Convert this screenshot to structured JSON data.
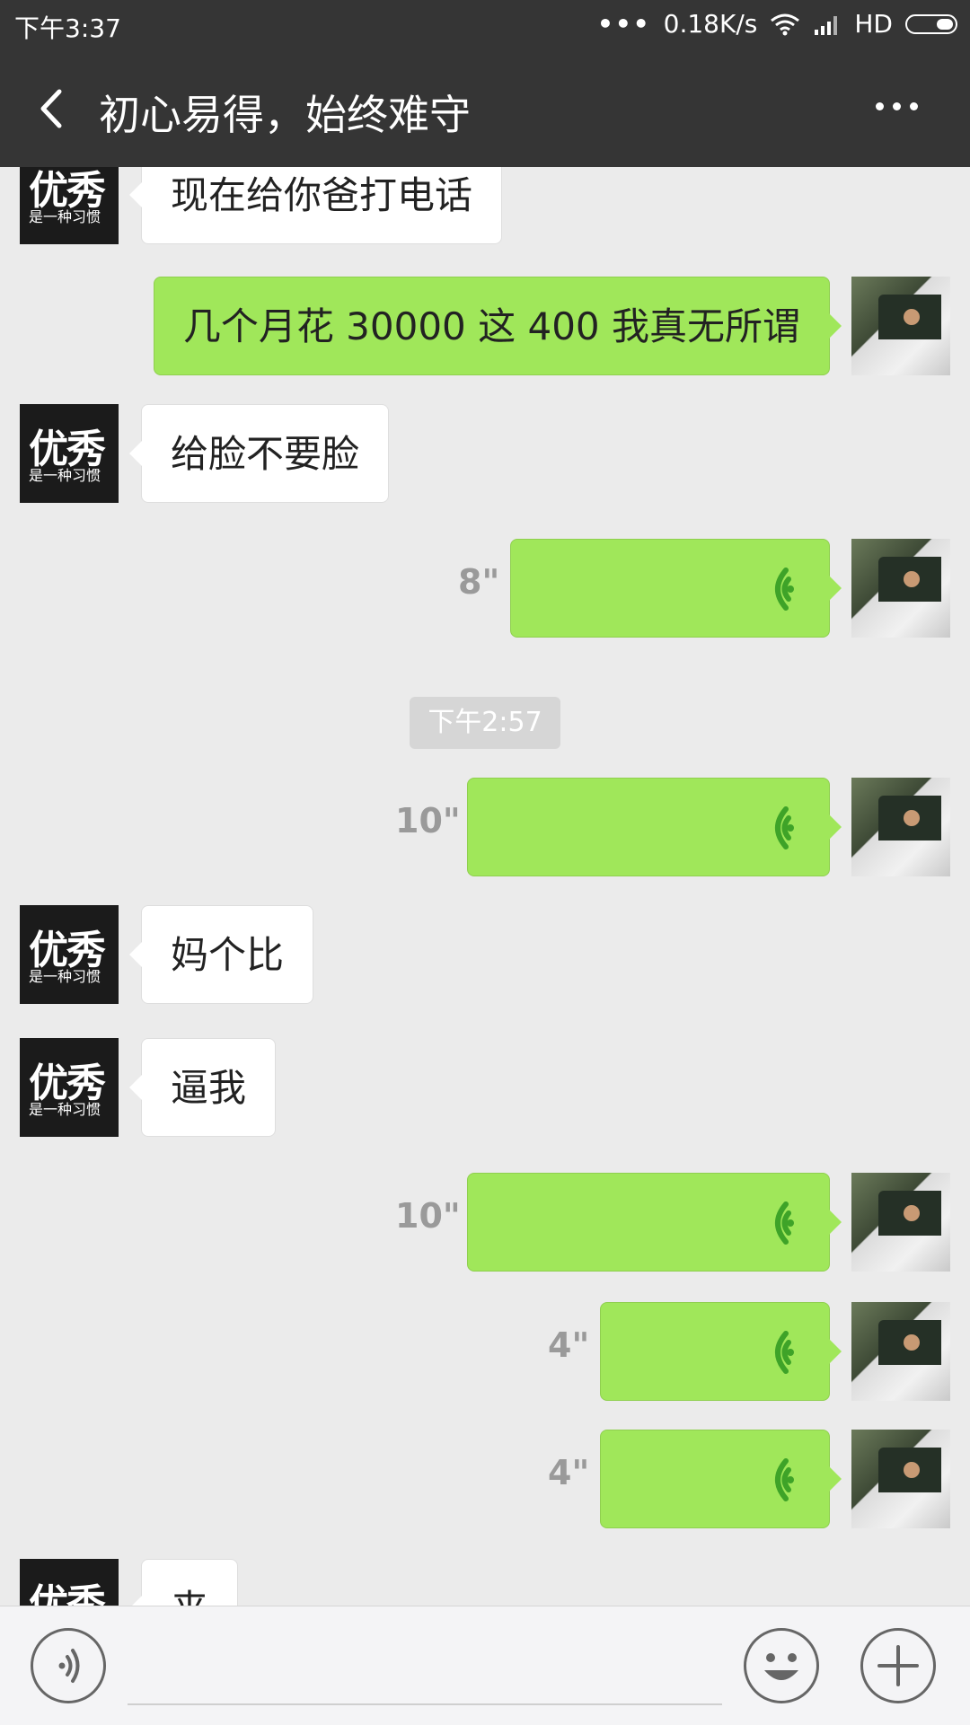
{
  "status_bar": {
    "time": "下午3:37",
    "dots": "•••",
    "network_speed": "0.18K/s",
    "hd": "HD"
  },
  "header": {
    "title": "初心易得，始终难守"
  },
  "friend_avatar": {
    "line1": "优秀",
    "line2": "是一种习惯"
  },
  "messages": [
    {
      "text": "现在给你爸打电话"
    },
    {
      "text": "几个月花 30000 这 400 我真无所谓"
    },
    {
      "text": "给脸不要脸"
    },
    {
      "duration": "8\""
    },
    {
      "duration": "10\""
    },
    {
      "text": "妈个比"
    },
    {
      "text": "逼我"
    },
    {
      "duration": "10\""
    },
    {
      "duration": "4\""
    },
    {
      "duration": "4\""
    },
    {
      "text": "来"
    }
  ],
  "timestamp": "下午2:57",
  "colors": {
    "bar": "#353535",
    "chat_bg": "#ebebeb",
    "my_bubble": "#a0e75a",
    "friend_bubble": "#ffffff"
  }
}
